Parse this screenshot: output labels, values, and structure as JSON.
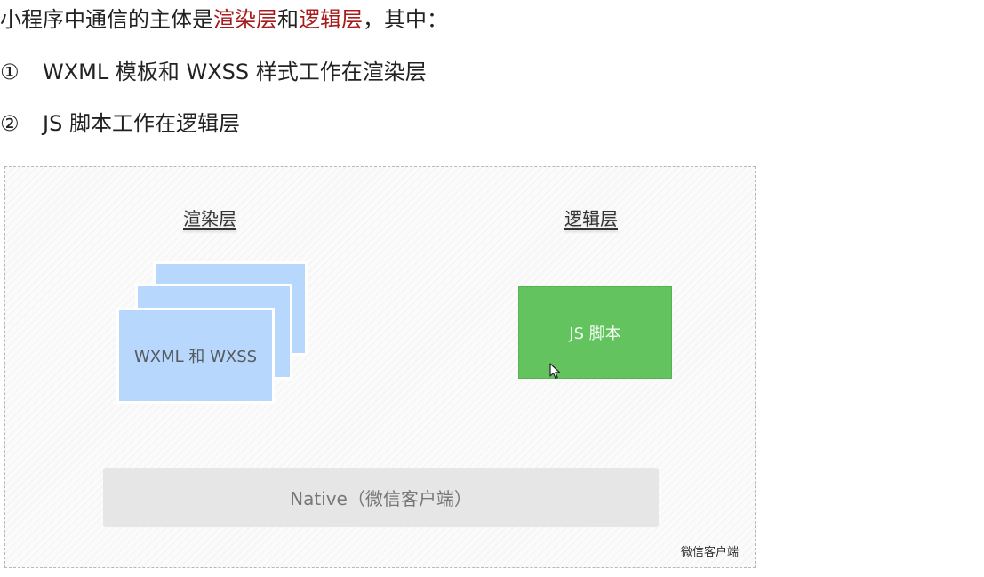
{
  "intro": {
    "prefix": "小程序中通信的主体是",
    "render_layer": "渲染层",
    "conj": "和",
    "logic_layer": "逻辑层",
    "suffix": "，其中："
  },
  "points": [
    {
      "marker": "①",
      "text": "WXML 模板和 WXSS 样式工作在渲染层"
    },
    {
      "marker": "②",
      "text": "JS 脚本工作在逻辑层"
    }
  ],
  "diagram": {
    "render_title": "渲染层",
    "logic_title": "逻辑层",
    "render_card_label": "WXML 和 WXSS",
    "logic_box_label": "JS 脚本",
    "native_label": "Native（微信客户端）",
    "client_label": "微信客户端",
    "colors": {
      "highlight_text": "#a61b1b",
      "render_card": "#b8d7fc",
      "logic_box": "#62c35f",
      "native_bar": "#e6e6e6"
    },
    "cursor_icon": "mouse-pointer-icon"
  }
}
